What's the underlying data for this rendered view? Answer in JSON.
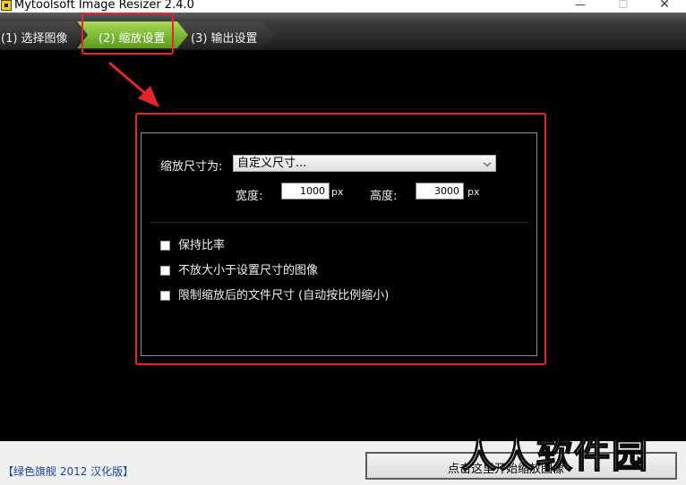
{
  "window": {
    "title": "Mytoolsoft Image Resizer 2.4.0",
    "minimize_glyph": "—",
    "maximize_glyph": "☐",
    "close_glyph": "✕"
  },
  "steps": [
    {
      "label": "(1) 选择图像",
      "active": false
    },
    {
      "label": "(2) 缩放设置",
      "active": true
    },
    {
      "label": "(3) 输出设置",
      "active": false
    }
  ],
  "settings": {
    "scale_label": "缩放尺寸为:",
    "scale_value": "自定义尺寸...",
    "width_label": "宽度:",
    "width_value": "1000",
    "height_label": "高度:",
    "height_value": "3000",
    "unit": "px",
    "options": [
      {
        "label": "保持比率",
        "checked": false
      },
      {
        "label": "不放大小于设置尺寸的图像",
        "checked": false
      },
      {
        "label": "限制缩放后的文件尺寸 (自动按比例缩小)",
        "checked": false
      }
    ]
  },
  "footer": {
    "brand": "【绿色旗舰 2012 汉化版】",
    "start_button": "点击这里开始缩放图像"
  },
  "watermark": "人人软件园",
  "colors": {
    "active_step": "#7cbc34",
    "annotation": "#e8242a",
    "brand_text": "#1b43a6"
  },
  "icons": {
    "app": "app-logo-icon",
    "dropdown": "chevron-down-icon",
    "annotation": "annotation-arrow-icon"
  }
}
